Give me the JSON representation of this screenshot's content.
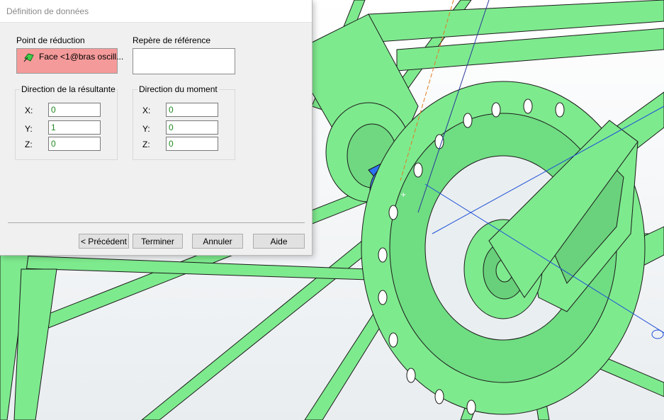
{
  "dialog": {
    "title": "Définition de données",
    "reduction_point": {
      "label": "Point de réduction",
      "selection": "Face <1@bras oscill..."
    },
    "reference_frame": {
      "label": "Repère de référence",
      "value": ""
    },
    "resultant_direction": {
      "label": "Direction de la résultante",
      "x_label": "X:",
      "x": "0",
      "y_label": "Y:",
      "y": "1",
      "z_label": "Z:",
      "z": "0"
    },
    "moment_direction": {
      "label": "Direction du moment",
      "x_label": "X:",
      "x": "0",
      "y_label": "Y:",
      "y": "0",
      "z_label": "Z:",
      "z": "0"
    },
    "buttons": {
      "previous": "< Précédent",
      "finish": "Terminer",
      "cancel": "Annuler",
      "help": "Aide"
    }
  },
  "colors": {
    "model_green": "#7eea8e",
    "selection_red": "#f59a9a",
    "spacer_blue": "#2f7ff0"
  },
  "icons": {
    "selection_item": "face-selection-icon"
  }
}
